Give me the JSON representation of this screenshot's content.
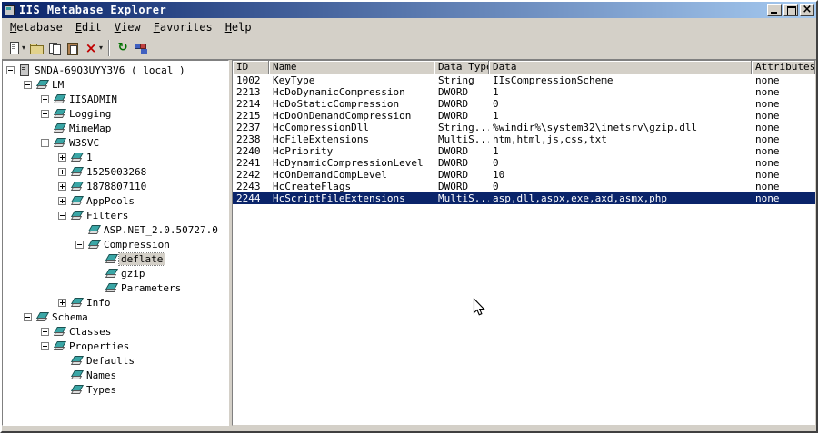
{
  "window": {
    "title": "IIS Metabase Explorer"
  },
  "menu": {
    "items": [
      "Metabase",
      "Edit",
      "View",
      "Favorites",
      "Help"
    ]
  },
  "toolbar": {
    "buttons": [
      {
        "name": "new-key-button",
        "icon": "page",
        "dropdown": true
      },
      {
        "name": "open-button",
        "icon": "folder"
      },
      {
        "name": "copy-button",
        "icon": "copy"
      },
      {
        "name": "paste-button",
        "icon": "paste"
      },
      {
        "name": "delete-button",
        "icon": "delete",
        "dropdown": true
      },
      {
        "sep": true
      },
      {
        "name": "refresh-button",
        "icon": "refresh"
      },
      {
        "name": "connect-button",
        "icon": "network"
      }
    ]
  },
  "tree": {
    "items": [
      {
        "label": "SNDA-69Q3UYY3V6 ( local )",
        "level": 0,
        "expander": "minus",
        "icon": "server"
      },
      {
        "label": "LM",
        "level": 1,
        "expander": "minus",
        "icon": "db"
      },
      {
        "label": "IISADMIN",
        "level": 2,
        "expander": "plus",
        "icon": "db"
      },
      {
        "label": "Logging",
        "level": 2,
        "expander": "plus",
        "icon": "db"
      },
      {
        "label": "MimeMap",
        "level": 2,
        "expander": "none",
        "icon": "db"
      },
      {
        "label": "W3SVC",
        "level": 2,
        "expander": "minus",
        "icon": "db"
      },
      {
        "label": "1",
        "level": 3,
        "expander": "plus",
        "icon": "db"
      },
      {
        "label": "1525003268",
        "level": 3,
        "expander": "plus",
        "icon": "db"
      },
      {
        "label": "1878807110",
        "level": 3,
        "expander": "plus",
        "icon": "db"
      },
      {
        "label": "AppPools",
        "level": 3,
        "expander": "plus",
        "icon": "db"
      },
      {
        "label": "Filters",
        "level": 3,
        "expander": "minus",
        "icon": "db"
      },
      {
        "label": "ASP.NET_2.0.50727.0",
        "level": 4,
        "expander": "none",
        "icon": "db"
      },
      {
        "label": "Compression",
        "level": 4,
        "expander": "minus",
        "icon": "db"
      },
      {
        "label": "deflate",
        "level": 5,
        "expander": "none",
        "icon": "db",
        "selected": true
      },
      {
        "label": "gzip",
        "level": 5,
        "expander": "none",
        "icon": "db"
      },
      {
        "label": "Parameters",
        "level": 5,
        "expander": "none",
        "icon": "db"
      },
      {
        "label": "Info",
        "level": 3,
        "expander": "plus",
        "icon": "db"
      },
      {
        "label": "Schema",
        "level": 1,
        "expander": "minus",
        "icon": "db"
      },
      {
        "label": "Classes",
        "level": 2,
        "expander": "plus",
        "icon": "db"
      },
      {
        "label": "Properties",
        "level": 2,
        "expander": "minus",
        "icon": "db"
      },
      {
        "label": "Defaults",
        "level": 3,
        "expander": "none",
        "icon": "db"
      },
      {
        "label": "Names",
        "level": 3,
        "expander": "none",
        "icon": "db"
      },
      {
        "label": "Types",
        "level": 3,
        "expander": "none",
        "icon": "db"
      }
    ]
  },
  "table": {
    "columns": [
      "ID",
      "Name",
      "Data Type",
      "Data",
      "Attributes"
    ],
    "rows": [
      [
        "1002",
        "KeyType",
        "String",
        "IIsCompressionScheme",
        "none"
      ],
      [
        "2213",
        "HcDoDynamicCompression",
        "DWORD",
        "1",
        "none"
      ],
      [
        "2214",
        "HcDoStaticCompression",
        "DWORD",
        "0",
        "none"
      ],
      [
        "2215",
        "HcDoOnDemandCompression",
        "DWORD",
        "1",
        "none"
      ],
      [
        "2237",
        "HcCompressionDll",
        "String...",
        "%windir%\\system32\\inetsrv\\gzip.dll",
        "none"
      ],
      [
        "2238",
        "HcFileExtensions",
        "MultiS...",
        "htm,html,js,css,txt",
        "none"
      ],
      [
        "2240",
        "HcPriority",
        "DWORD",
        "1",
        "none"
      ],
      [
        "2241",
        "HcDynamicCompressionLevel",
        "DWORD",
        "0",
        "none"
      ],
      [
        "2242",
        "HcOnDemandCompLevel",
        "DWORD",
        "10",
        "none"
      ],
      [
        "2243",
        "HcCreateFlags",
        "DWORD",
        "0",
        "none"
      ],
      [
        "2244",
        "HcScriptFileExtensions",
        "MultiS...",
        "asp,dll,aspx,exe,axd,asmx,php",
        "none"
      ]
    ],
    "selected_id": "2244"
  },
  "colors": {
    "titlebar_start": "#0a246a",
    "titlebar_end": "#a6caf0",
    "selection": "#0a246a",
    "chrome": "#d4d0c8"
  }
}
